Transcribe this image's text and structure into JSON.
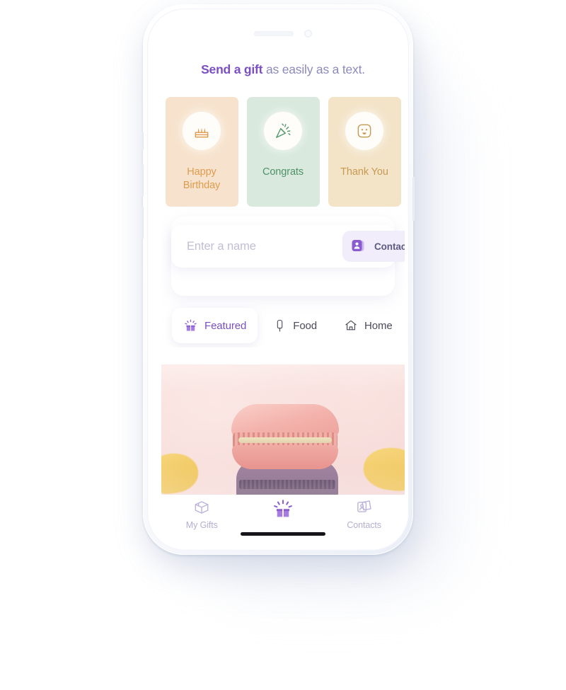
{
  "device": {
    "name": "smartphone-mockup",
    "speaker_icon": "speaker-slot",
    "camera_icon": "front-camera",
    "home_indicator": "home-indicator-bar"
  },
  "headline": {
    "bold": "Send a gift",
    "rest": " as easily as a text."
  },
  "categories": [
    {
      "label": "Happy\nBirthday",
      "label_line1": "Happy",
      "label_line2": "Birthday",
      "icon": "birthday-cake-icon",
      "bg": "#f7e3cd",
      "text_color": "#e09c4e",
      "icon_color": "#dd9a4f"
    },
    {
      "label": "Congrats",
      "label_line1": "Congrats",
      "label_line2": "",
      "icon": "party-popper-icon",
      "bg": "#d9e9dd",
      "text_color": "#4f9167",
      "icon_color": "#52996c"
    },
    {
      "label": "Thank You",
      "label_line1": "Thank You",
      "label_line2": "",
      "icon": "smiley-face-icon",
      "bg": "#f3e4c8",
      "text_color": "#c79a51",
      "icon_color": "#c79a51"
    }
  ],
  "search": {
    "placeholder": "Enter a name",
    "value": "",
    "contacts_label": "Contacts",
    "contacts_icon": "contact-card-icon",
    "accent": "#7a4fc4",
    "chip_bg": "#f1edfb"
  },
  "tabs": [
    {
      "label": "Featured",
      "icon": "sparkling-gift-icon",
      "active": true
    },
    {
      "label": "Food",
      "icon": "popsicle-icon",
      "active": false
    },
    {
      "label": "Home",
      "icon": "house-icon",
      "active": false
    },
    {
      "label": "",
      "icon": "candle-icon",
      "active": false
    }
  ],
  "product": {
    "alt": "pink-macaron-stacked-on-purple-macaron",
    "bg_color": "#f6dcd9"
  },
  "bottom_nav": [
    {
      "label": "My Gifts",
      "icon": "gift-box-3d-icon",
      "active": false
    },
    {
      "label": "",
      "icon": "sparkling-gift-icon",
      "active": true
    },
    {
      "label": "Contacts",
      "icon": "contact-cards-icon",
      "active": false
    }
  ],
  "colors": {
    "brand_purple": "#7a4fc4",
    "muted_purple": "#b6aed2",
    "headline_muted": "#8d8aba"
  }
}
